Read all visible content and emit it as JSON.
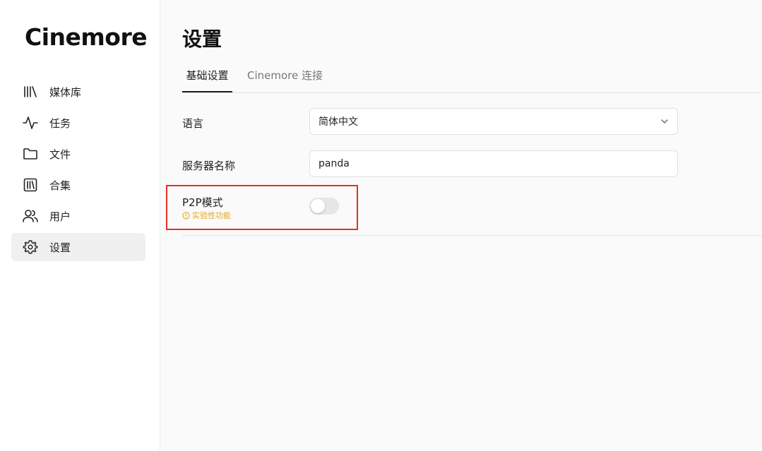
{
  "brand": "Cinemore",
  "nav": {
    "items": [
      {
        "label": "媒体库",
        "icon": "library-icon",
        "active": false
      },
      {
        "label": "任务",
        "icon": "activity-icon",
        "active": false
      },
      {
        "label": "文件",
        "icon": "folder-icon",
        "active": false
      },
      {
        "label": "合集",
        "icon": "collection-icon",
        "active": false
      },
      {
        "label": "用户",
        "icon": "users-icon",
        "active": false
      },
      {
        "label": "设置",
        "icon": "settings-gear-icon",
        "active": true
      }
    ]
  },
  "page": {
    "title": "设置",
    "tabs": [
      {
        "label": "基础设置",
        "active": true
      },
      {
        "label": "Cinemore 连接",
        "active": false
      }
    ]
  },
  "settings": {
    "language_label": "语言",
    "language_value": "简体中文",
    "server_name_label": "服务器名称",
    "server_name_value": "panda",
    "p2p_label": "P2P模式",
    "p2p_note": "实验性功能",
    "p2p_enabled": false
  },
  "colors": {
    "highlight": "#e0322b",
    "warning": "#e0a820",
    "active_nav_bg": "#f0f0f0"
  }
}
